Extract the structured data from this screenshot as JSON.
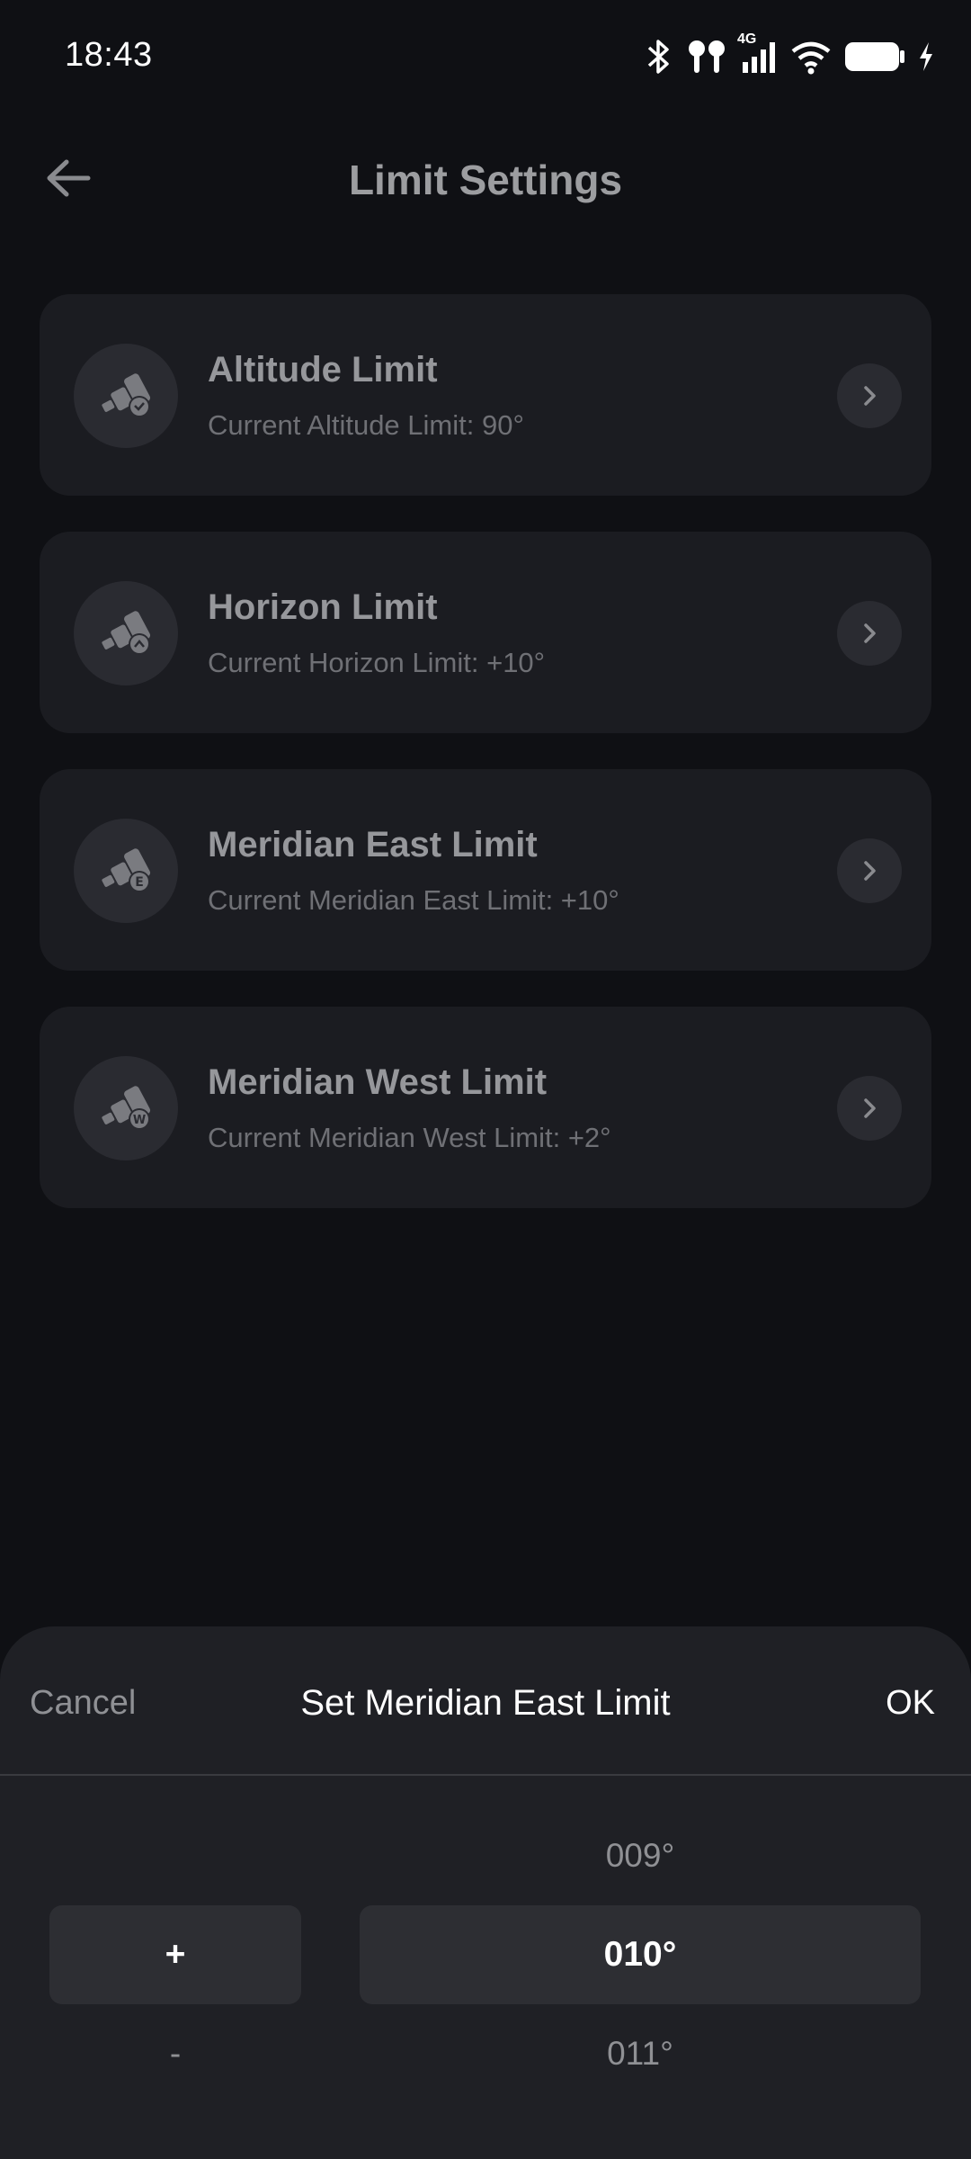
{
  "status_bar": {
    "time": "18:43",
    "network": "4G",
    "icons": [
      "bluetooth-icon",
      "earbuds-icon",
      "signal-icon",
      "wifi-icon",
      "battery-icon",
      "charging-icon"
    ]
  },
  "header": {
    "title": "Limit Settings",
    "back_icon": "arrow-left-icon"
  },
  "limits": [
    {
      "title": "Altitude Limit",
      "subtitle": "Current Altitude Limit: 90°",
      "badge": "check"
    },
    {
      "title": "Horizon Limit",
      "subtitle": "Current Horizon Limit: +10°",
      "badge": "up"
    },
    {
      "title": "Meridian East Limit",
      "subtitle": "Current Meridian East Limit: +10°",
      "badge": "E"
    },
    {
      "title": "Meridian West Limit",
      "subtitle": "Current Meridian West Limit: +2°",
      "badge": "W"
    }
  ],
  "sheet": {
    "cancel_label": "Cancel",
    "title": "Set Meridian East Limit",
    "ok_label": "OK",
    "sign_picker": {
      "options": [
        "",
        "+",
        "-"
      ],
      "selected": "+"
    },
    "value_picker": {
      "options": [
        "009°",
        "010°",
        "011°"
      ],
      "selected": "010°"
    }
  },
  "colors": {
    "background": "#0f1014",
    "card": "#1b1c21",
    "sheet": "#1f2025",
    "selected_row": "#2d2e33",
    "muted_text": "#8f9094"
  }
}
